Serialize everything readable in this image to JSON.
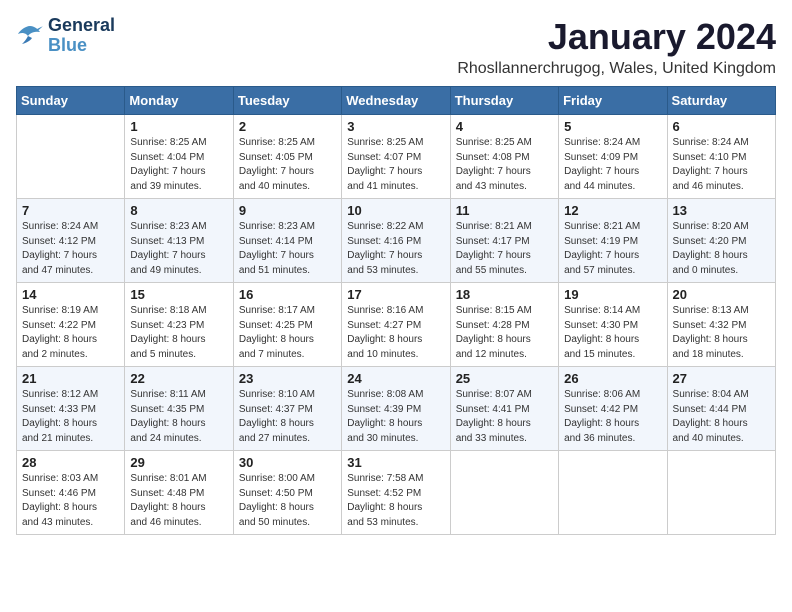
{
  "logo": {
    "line1": "General",
    "line2": "Blue"
  },
  "title": "January 2024",
  "subtitle": "Rhosllannerchrugog, Wales, United Kingdom",
  "days_header": [
    "Sunday",
    "Monday",
    "Tuesday",
    "Wednesday",
    "Thursday",
    "Friday",
    "Saturday"
  ],
  "weeks": [
    [
      {
        "day": "",
        "info": ""
      },
      {
        "day": "1",
        "info": "Sunrise: 8:25 AM\nSunset: 4:04 PM\nDaylight: 7 hours\nand 39 minutes."
      },
      {
        "day": "2",
        "info": "Sunrise: 8:25 AM\nSunset: 4:05 PM\nDaylight: 7 hours\nand 40 minutes."
      },
      {
        "day": "3",
        "info": "Sunrise: 8:25 AM\nSunset: 4:07 PM\nDaylight: 7 hours\nand 41 minutes."
      },
      {
        "day": "4",
        "info": "Sunrise: 8:25 AM\nSunset: 4:08 PM\nDaylight: 7 hours\nand 43 minutes."
      },
      {
        "day": "5",
        "info": "Sunrise: 8:24 AM\nSunset: 4:09 PM\nDaylight: 7 hours\nand 44 minutes."
      },
      {
        "day": "6",
        "info": "Sunrise: 8:24 AM\nSunset: 4:10 PM\nDaylight: 7 hours\nand 46 minutes."
      }
    ],
    [
      {
        "day": "7",
        "info": "Sunrise: 8:24 AM\nSunset: 4:12 PM\nDaylight: 7 hours\nand 47 minutes."
      },
      {
        "day": "8",
        "info": "Sunrise: 8:23 AM\nSunset: 4:13 PM\nDaylight: 7 hours\nand 49 minutes."
      },
      {
        "day": "9",
        "info": "Sunrise: 8:23 AM\nSunset: 4:14 PM\nDaylight: 7 hours\nand 51 minutes."
      },
      {
        "day": "10",
        "info": "Sunrise: 8:22 AM\nSunset: 4:16 PM\nDaylight: 7 hours\nand 53 minutes."
      },
      {
        "day": "11",
        "info": "Sunrise: 8:21 AM\nSunset: 4:17 PM\nDaylight: 7 hours\nand 55 minutes."
      },
      {
        "day": "12",
        "info": "Sunrise: 8:21 AM\nSunset: 4:19 PM\nDaylight: 7 hours\nand 57 minutes."
      },
      {
        "day": "13",
        "info": "Sunrise: 8:20 AM\nSunset: 4:20 PM\nDaylight: 8 hours\nand 0 minutes."
      }
    ],
    [
      {
        "day": "14",
        "info": "Sunrise: 8:19 AM\nSunset: 4:22 PM\nDaylight: 8 hours\nand 2 minutes."
      },
      {
        "day": "15",
        "info": "Sunrise: 8:18 AM\nSunset: 4:23 PM\nDaylight: 8 hours\nand 5 minutes."
      },
      {
        "day": "16",
        "info": "Sunrise: 8:17 AM\nSunset: 4:25 PM\nDaylight: 8 hours\nand 7 minutes."
      },
      {
        "day": "17",
        "info": "Sunrise: 8:16 AM\nSunset: 4:27 PM\nDaylight: 8 hours\nand 10 minutes."
      },
      {
        "day": "18",
        "info": "Sunrise: 8:15 AM\nSunset: 4:28 PM\nDaylight: 8 hours\nand 12 minutes."
      },
      {
        "day": "19",
        "info": "Sunrise: 8:14 AM\nSunset: 4:30 PM\nDaylight: 8 hours\nand 15 minutes."
      },
      {
        "day": "20",
        "info": "Sunrise: 8:13 AM\nSunset: 4:32 PM\nDaylight: 8 hours\nand 18 minutes."
      }
    ],
    [
      {
        "day": "21",
        "info": "Sunrise: 8:12 AM\nSunset: 4:33 PM\nDaylight: 8 hours\nand 21 minutes."
      },
      {
        "day": "22",
        "info": "Sunrise: 8:11 AM\nSunset: 4:35 PM\nDaylight: 8 hours\nand 24 minutes."
      },
      {
        "day": "23",
        "info": "Sunrise: 8:10 AM\nSunset: 4:37 PM\nDaylight: 8 hours\nand 27 minutes."
      },
      {
        "day": "24",
        "info": "Sunrise: 8:08 AM\nSunset: 4:39 PM\nDaylight: 8 hours\nand 30 minutes."
      },
      {
        "day": "25",
        "info": "Sunrise: 8:07 AM\nSunset: 4:41 PM\nDaylight: 8 hours\nand 33 minutes."
      },
      {
        "day": "26",
        "info": "Sunrise: 8:06 AM\nSunset: 4:42 PM\nDaylight: 8 hours\nand 36 minutes."
      },
      {
        "day": "27",
        "info": "Sunrise: 8:04 AM\nSunset: 4:44 PM\nDaylight: 8 hours\nand 40 minutes."
      }
    ],
    [
      {
        "day": "28",
        "info": "Sunrise: 8:03 AM\nSunset: 4:46 PM\nDaylight: 8 hours\nand 43 minutes."
      },
      {
        "day": "29",
        "info": "Sunrise: 8:01 AM\nSunset: 4:48 PM\nDaylight: 8 hours\nand 46 minutes."
      },
      {
        "day": "30",
        "info": "Sunrise: 8:00 AM\nSunset: 4:50 PM\nDaylight: 8 hours\nand 50 minutes."
      },
      {
        "day": "31",
        "info": "Sunrise: 7:58 AM\nSunset: 4:52 PM\nDaylight: 8 hours\nand 53 minutes."
      },
      {
        "day": "",
        "info": ""
      },
      {
        "day": "",
        "info": ""
      },
      {
        "day": "",
        "info": ""
      }
    ]
  ]
}
